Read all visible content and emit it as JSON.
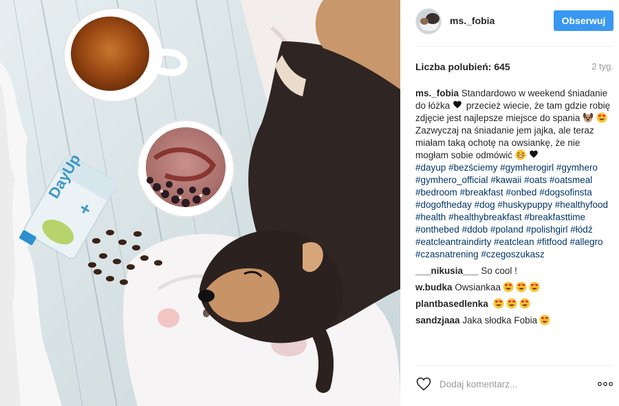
{
  "post": {
    "username": "ms._fobia",
    "follow_label": "Obserwuj",
    "likes_label": "Liczba polubień:",
    "likes_count": "645",
    "timestamp": "2 tyg."
  },
  "caption": {
    "username": "ms._fobia",
    "text_part1": "Standardowo w weekend śniadanie do łóżka",
    "text_part2": "przecież wiecie, że tam gdzie robię zdjęcie jest najlepsze miejsce do spania",
    "text_part3": "Zazwyczaj na śniadanie jem jajka, ale teraz miałam taką ochotę na owsiankę, że nie mogłam sobie odmówić",
    "hashtags": [
      "#dayup",
      "#bezściemy",
      "#gymherogirl",
      "#gymhero",
      "#gymhero_official",
      "#kawaii",
      "#oats",
      "#oatsmeal",
      "#bedroom",
      "#breakfast",
      "#onbed",
      "#dogsofinsta",
      "#dogoftheday",
      "#dog",
      "#huskypuppy",
      "#healthyfood",
      "#health",
      "#healthybreakfast",
      "#breakfasttime",
      "#onthebed",
      "#ddob",
      "#poland",
      "#polishgirl",
      "#łódź",
      "#eatcleantraindirty",
      "#eatclean",
      "#fitfood",
      "#allegro",
      "#czasnatrening",
      "#czegoszukasz"
    ]
  },
  "comments": [
    {
      "username": "___nikusia___",
      "text": "So cool !",
      "emoji": []
    },
    {
      "username": "w.budka",
      "text": "Owsiankaa",
      "emoji": [
        "heart-eyes",
        "heart-eyes",
        "heart-eyes"
      ]
    },
    {
      "username": "plantbasedlenka",
      "text": "",
      "emoji": [
        "heart-eyes",
        "heart-eyes",
        "heart-eyes"
      ]
    },
    {
      "username": "sandzjaaa",
      "text": "Jaka słodka Fobia",
      "emoji": [
        "heart-eyes"
      ]
    }
  ],
  "comment_box": {
    "placeholder": "Dodaj komentarz..."
  },
  "icons": {
    "like": "heart-outline-icon",
    "more": "ellipsis-icon",
    "heart_inline": "black-heart-icon",
    "dog_emoji": "dog-face-icon",
    "emoji_heart_eyes": "heart-eyes-emoji-icon",
    "emoji_grin": "grinning-squint-emoji-icon"
  },
  "colors": {
    "follow_button": "#3897f0",
    "hashtag": "#003569",
    "muted": "#999999",
    "divider": "#efefef"
  }
}
